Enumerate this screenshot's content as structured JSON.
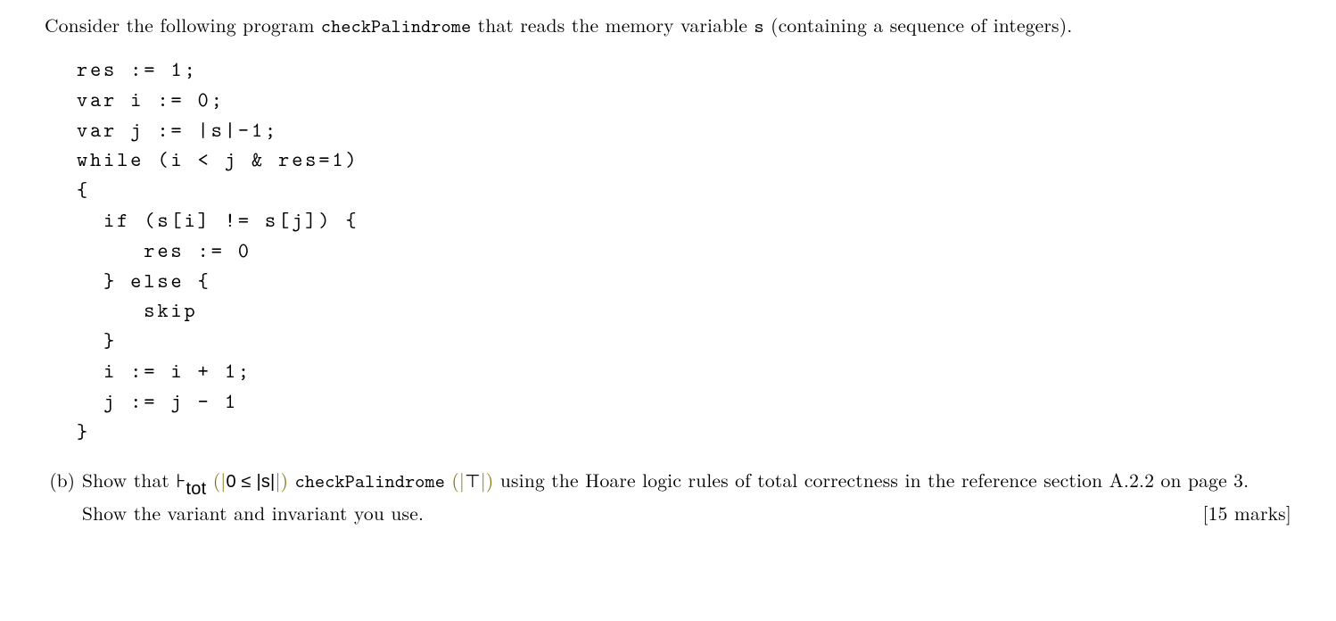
{
  "intro_text_1": "Consider the following program ",
  "intro_code": "checkPalindrome",
  "intro_text_2": " that reads the memory variable ",
  "intro_var": "s",
  "intro_text_3": " (containing a sequence of integers).",
  "code": {
    "l1": "res := 1;",
    "l2": "var i := 0;",
    "l3": "var j := |s|-1;",
    "l4": "while (i < j & res=1)",
    "l5": "{",
    "l6": "  if (s[i] != s[j]) {",
    "l7": "     res := 0",
    "l8": "  } else {",
    "l9": "     skip",
    "l10": "  }",
    "l11": "  i := i + 1;",
    "l12": "  j := j - 1",
    "l13": "}"
  },
  "part_b": {
    "label": "(b)",
    "text_1": "Show that ",
    "turnstile": "⊦",
    "sub": "tot",
    "pre_open": "(|",
    "pre_body": "0 ≤ |s|",
    "pre_close": "|)",
    "prog": "checkPalindrome",
    "post_open": "(|",
    "post_body": "⊤",
    "post_close": "|)",
    "text_2": " using the Hoare logic rules of total correctness in the reference section A.2.2 on page 3. Show the variant and invariant you use.",
    "marks": "[15 marks]"
  }
}
